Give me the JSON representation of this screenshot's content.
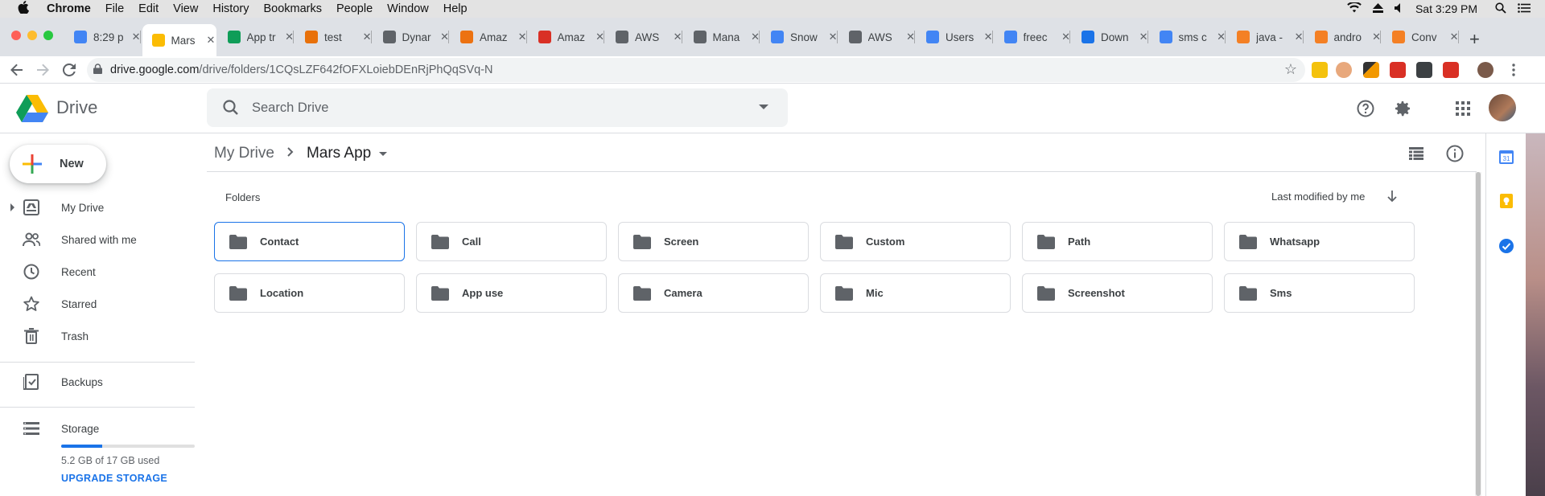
{
  "menubar": {
    "app_name": "Chrome",
    "items": [
      "File",
      "Edit",
      "View",
      "History",
      "Bookmarks",
      "People",
      "Window",
      "Help"
    ],
    "clock": "Sat 3:29 PM"
  },
  "tabs": [
    {
      "title": "8:29 p",
      "icon": "docs-icon",
      "color": "#4285f4",
      "active": false
    },
    {
      "title": "Mars",
      "icon": "drive-icon",
      "color": "#fbbc04",
      "active": true
    },
    {
      "title": "App tr",
      "icon": "sheets-icon",
      "color": "#0f9d58",
      "active": false
    },
    {
      "title": "test",
      "icon": "photo-icon",
      "color": "#e8710a",
      "active": false
    },
    {
      "title": "Dynar",
      "icon": "dynamo-icon",
      "color": "#5f6368",
      "active": false
    },
    {
      "title": "Amaz",
      "icon": "aws-box-icon",
      "color": "#ec7211",
      "active": false
    },
    {
      "title": "Amaz",
      "icon": "gmail-icon",
      "color": "#d93025",
      "active": false
    },
    {
      "title": "AWS",
      "icon": "globe-icon",
      "color": "#5f6368",
      "active": false
    },
    {
      "title": "Mana",
      "icon": "globe-icon",
      "color": "#5f6368",
      "active": false
    },
    {
      "title": "Snow",
      "icon": "snow-icon",
      "color": "#4285f4",
      "active": false
    },
    {
      "title": "AWS",
      "icon": "globe-icon",
      "color": "#5f6368",
      "active": false
    },
    {
      "title": "Users",
      "icon": "users-icon",
      "color": "#4285f4",
      "active": false
    },
    {
      "title": "freec",
      "icon": "google-icon",
      "color": "#4285f4",
      "active": false
    },
    {
      "title": "Down",
      "icon": "download-icon",
      "color": "#1a73e8",
      "active": false
    },
    {
      "title": "sms c",
      "icon": "google-icon",
      "color": "#4285f4",
      "active": false
    },
    {
      "title": "java -",
      "icon": "stackoverflow-icon",
      "color": "#f48024",
      "active": false
    },
    {
      "title": "andro",
      "icon": "stackoverflow-icon",
      "color": "#f48024",
      "active": false
    },
    {
      "title": "Conv",
      "icon": "stackoverflow-icon",
      "color": "#f48024",
      "active": false
    }
  ],
  "address_bar": {
    "domain": "drive.google.com",
    "path": "/drive/folders/1CQsLZF642fOFXLoiebDEnRjPhQqSVq-N"
  },
  "drive": {
    "product_name": "Drive",
    "search_placeholder": "Search Drive",
    "new_label": "New",
    "nav": [
      {
        "label": "My Drive",
        "icon": "my-drive-icon"
      },
      {
        "label": "Shared with me",
        "icon": "shared-icon"
      },
      {
        "label": "Recent",
        "icon": "clock-icon"
      },
      {
        "label": "Starred",
        "icon": "star-icon"
      },
      {
        "label": "Trash",
        "icon": "trash-icon"
      },
      {
        "label": "Backups",
        "icon": "backups-icon"
      },
      {
        "label": "Storage",
        "icon": "storage-icon"
      }
    ],
    "storage_text": "5.2 GB of 17 GB used",
    "storage_fraction": 0.31,
    "upgrade_label": "UPGRADE STORAGE",
    "breadcrumb": {
      "root": "My Drive",
      "current": "Mars App"
    },
    "folders_label": "Folders",
    "sort_label": "Last modified by me",
    "folders": [
      "Contact",
      "Call",
      "Screen",
      "Custom",
      "Path",
      "Whatsapp",
      "Location",
      "App use",
      "Camera",
      "Mic",
      "Screenshot",
      "Sms"
    ],
    "selected_folder": "Contact"
  },
  "colors": {
    "accent": "#1a73e8",
    "folder_icon": "#5f6368"
  }
}
